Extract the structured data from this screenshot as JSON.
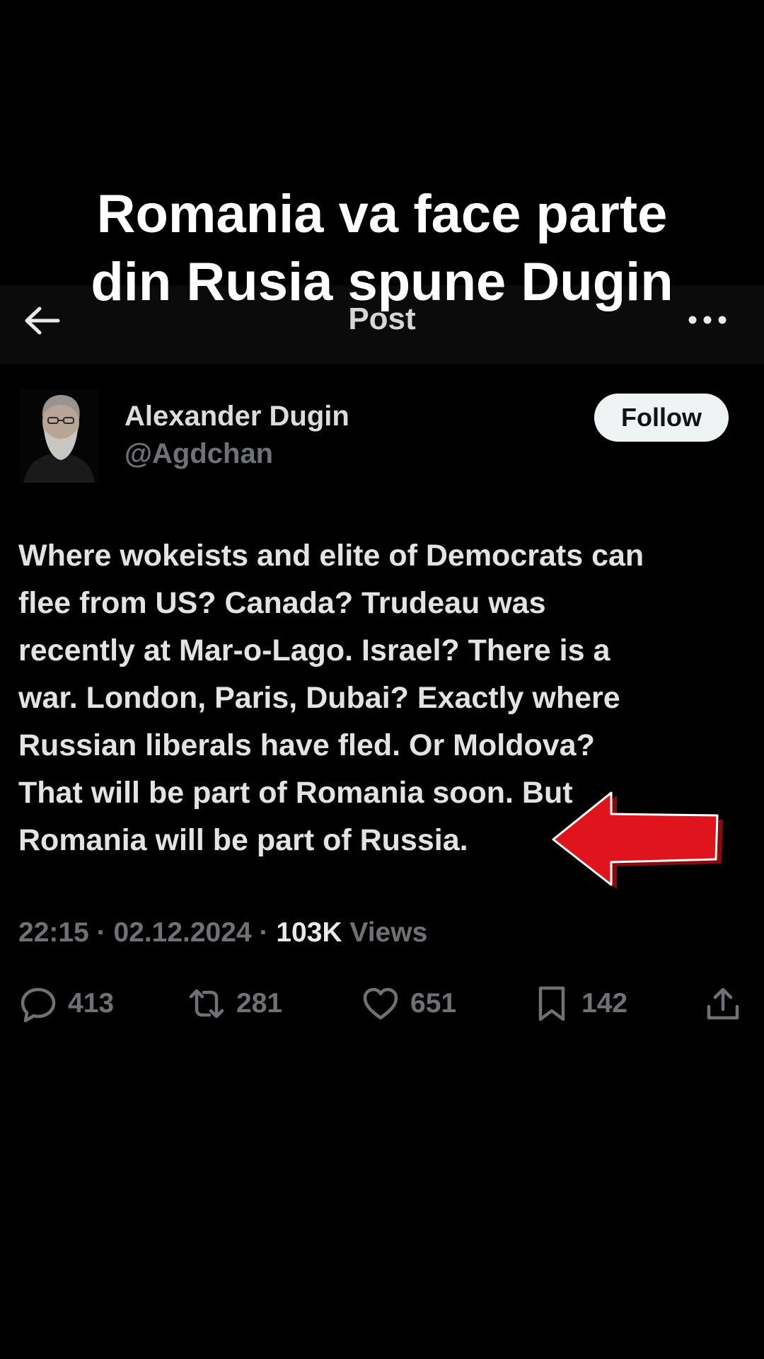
{
  "overlay": {
    "line1": "Romania va face parte",
    "line2": "din Rusia spune Dugin"
  },
  "header": {
    "title": "Post",
    "back_icon": "arrow-left-icon",
    "more_icon": "more-horizontal-icon"
  },
  "author": {
    "name": "Alexander Dugin",
    "handle": "@Agdchan",
    "follow_label": "Follow"
  },
  "tweet": {
    "lines": [
      "Where wokeists and elite of Democrats can",
      "flee from US? Canada? Trudeau was",
      "recently at Mar-o-Lago. Israel? There is a",
      "war. London, Paris, Dubai? Exactly where",
      "Russian liberals have fled. Or Moldova?",
      "That will be part of Romania soon. But",
      "Romania will be part of Russia."
    ]
  },
  "meta": {
    "time": "22:15",
    "date": "02.12.2024",
    "views_count": "103K",
    "views_label": "Views",
    "separator": "·"
  },
  "actions": {
    "replies": "413",
    "reposts": "281",
    "likes": "651",
    "bookmarks": "142"
  },
  "colors": {
    "background": "#000000",
    "text": "#e7e9ea",
    "muted": "#6e7276",
    "follow_bg": "#eff3f4",
    "arrow_red": "#e0141c"
  }
}
